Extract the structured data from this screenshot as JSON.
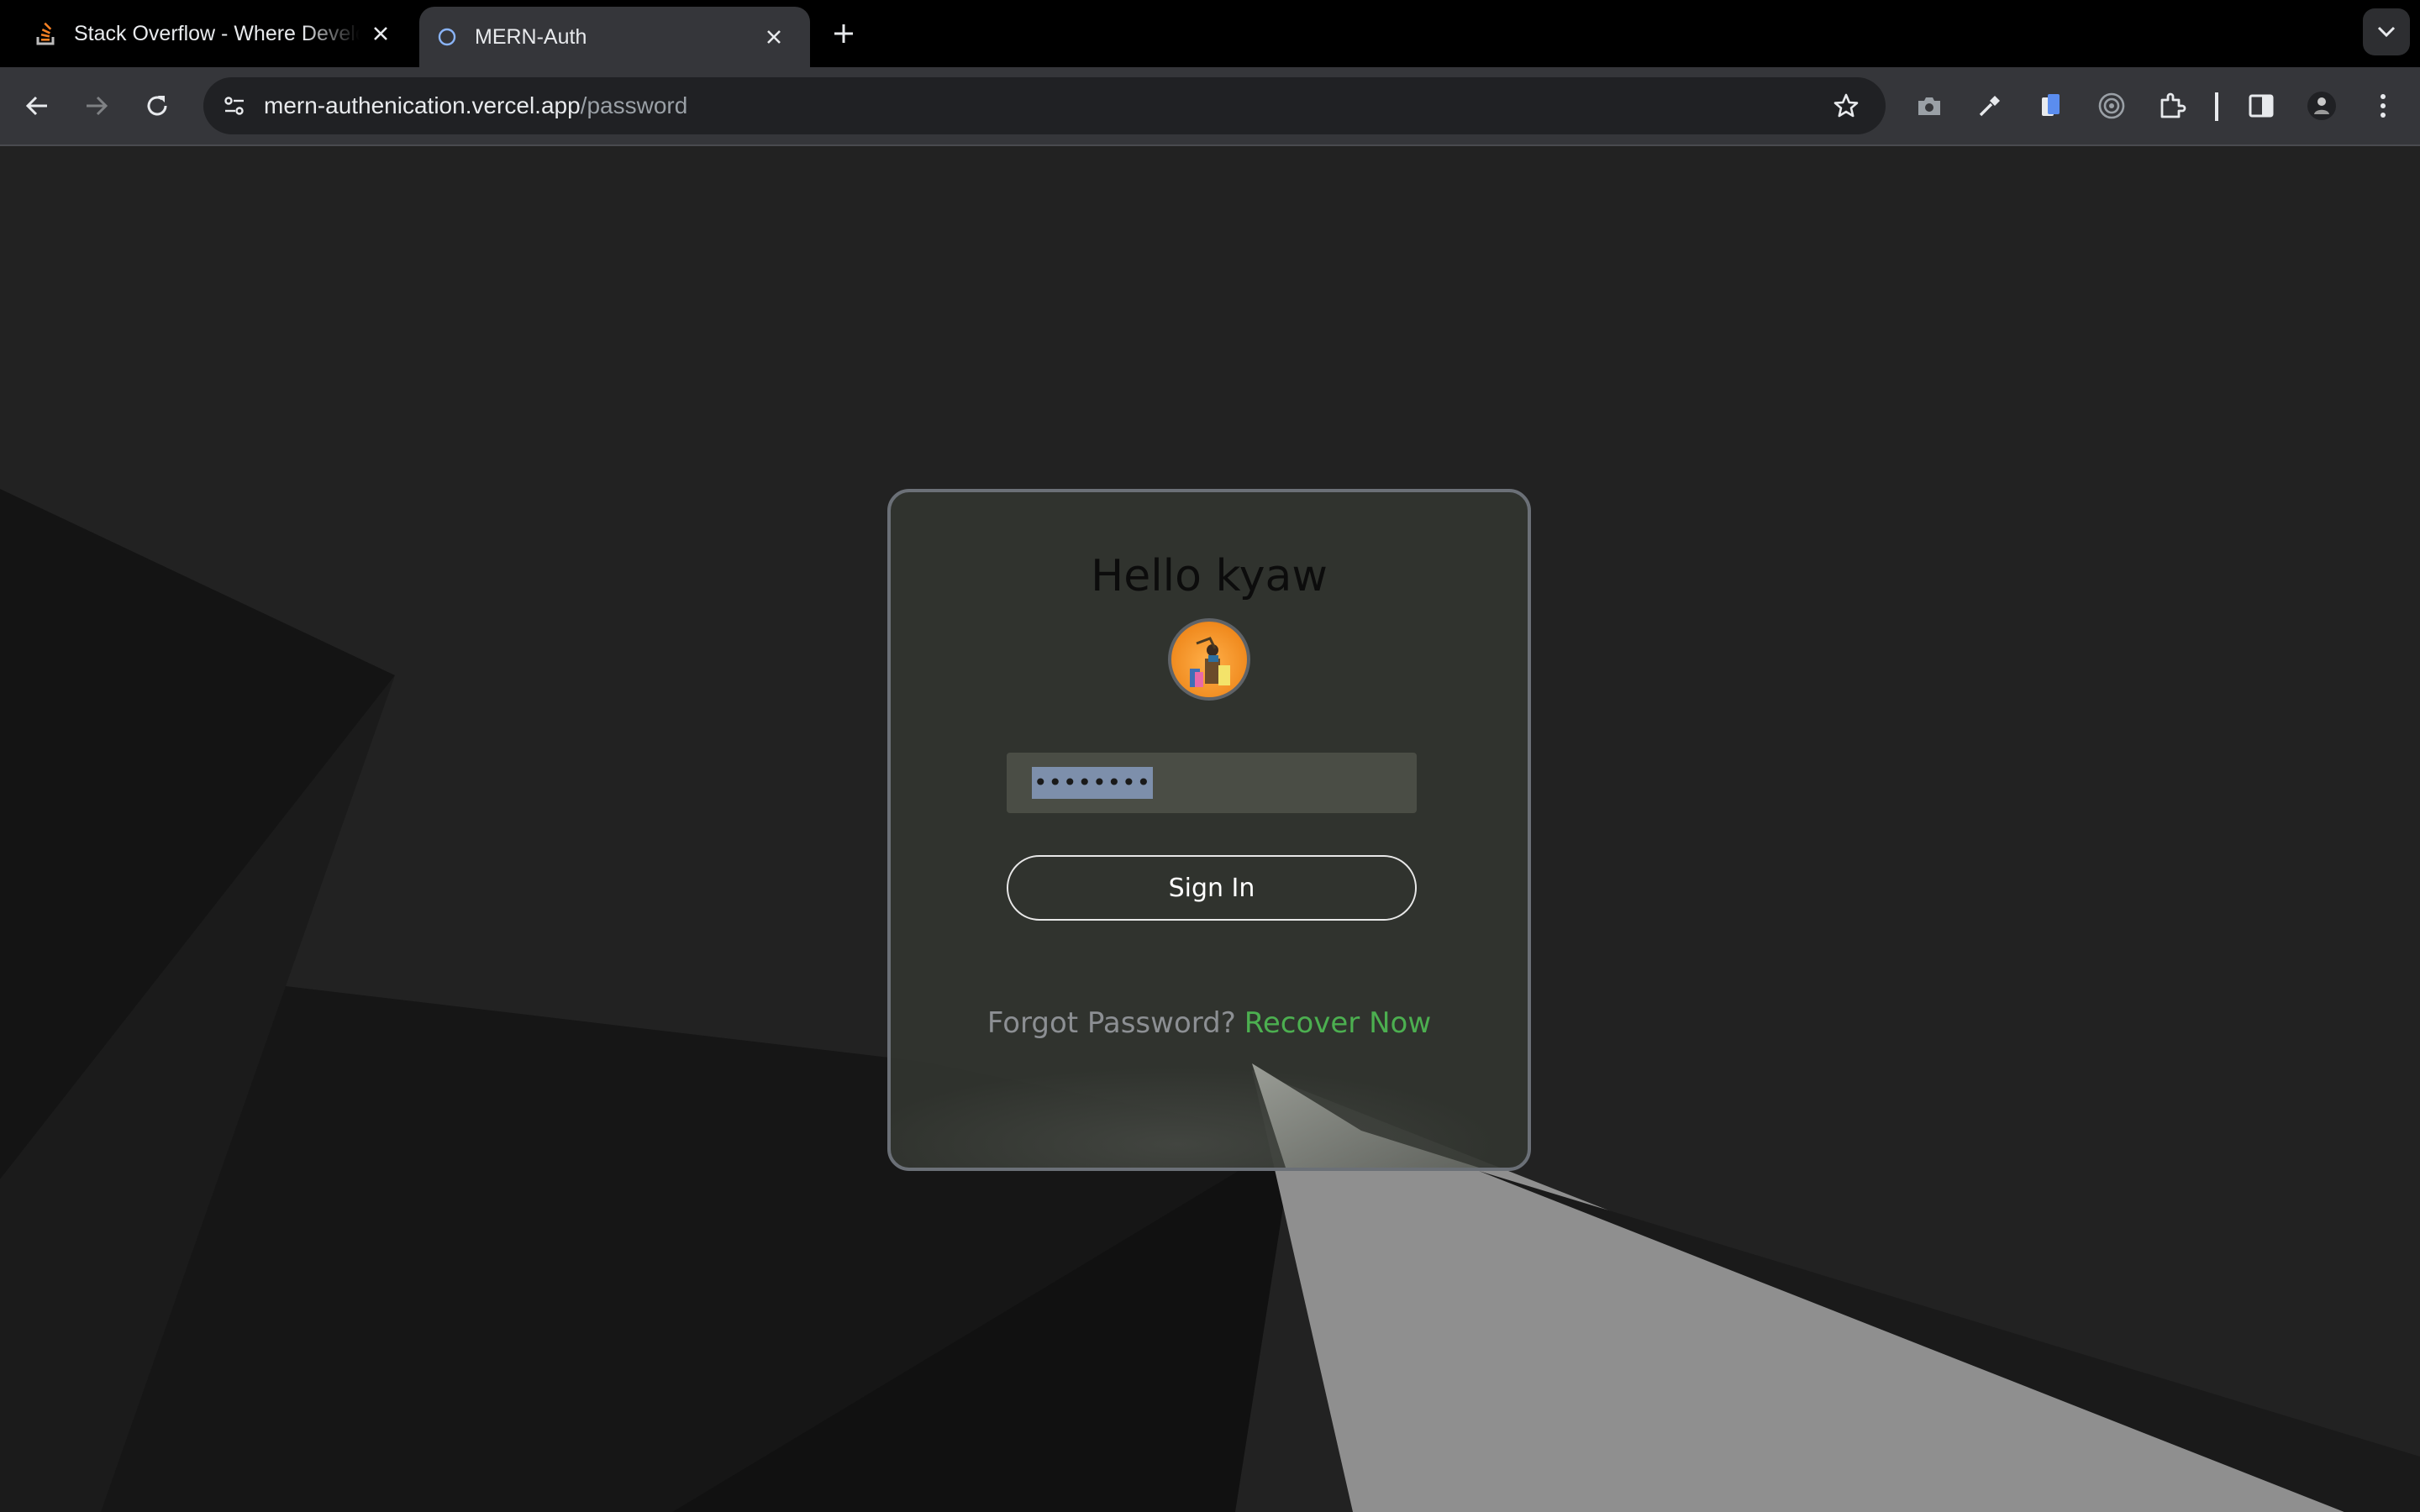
{
  "browser": {
    "tabs": [
      {
        "title": "Stack Overflow - Where Developers Learn, Share, & Build Careers",
        "favicon": "stackoverflow-icon",
        "active": false
      },
      {
        "title": "MERN-Auth",
        "favicon": "globe-loading-icon",
        "active": true
      }
    ],
    "address_bar": {
      "host": "mern-authenication.vercel.app",
      "path": "/password"
    }
  },
  "page": {
    "greeting": "Hello kyaw",
    "password_value": "••••••••",
    "password_masked": "••••••••",
    "signin_label": "Sign In",
    "forgot_text": "Forgot Password?",
    "recover_link": "Recover Now"
  },
  "colors": {
    "background": "#222222",
    "card": "#323530",
    "recover_link": "#4caf50",
    "selection": "#7d8fab"
  }
}
